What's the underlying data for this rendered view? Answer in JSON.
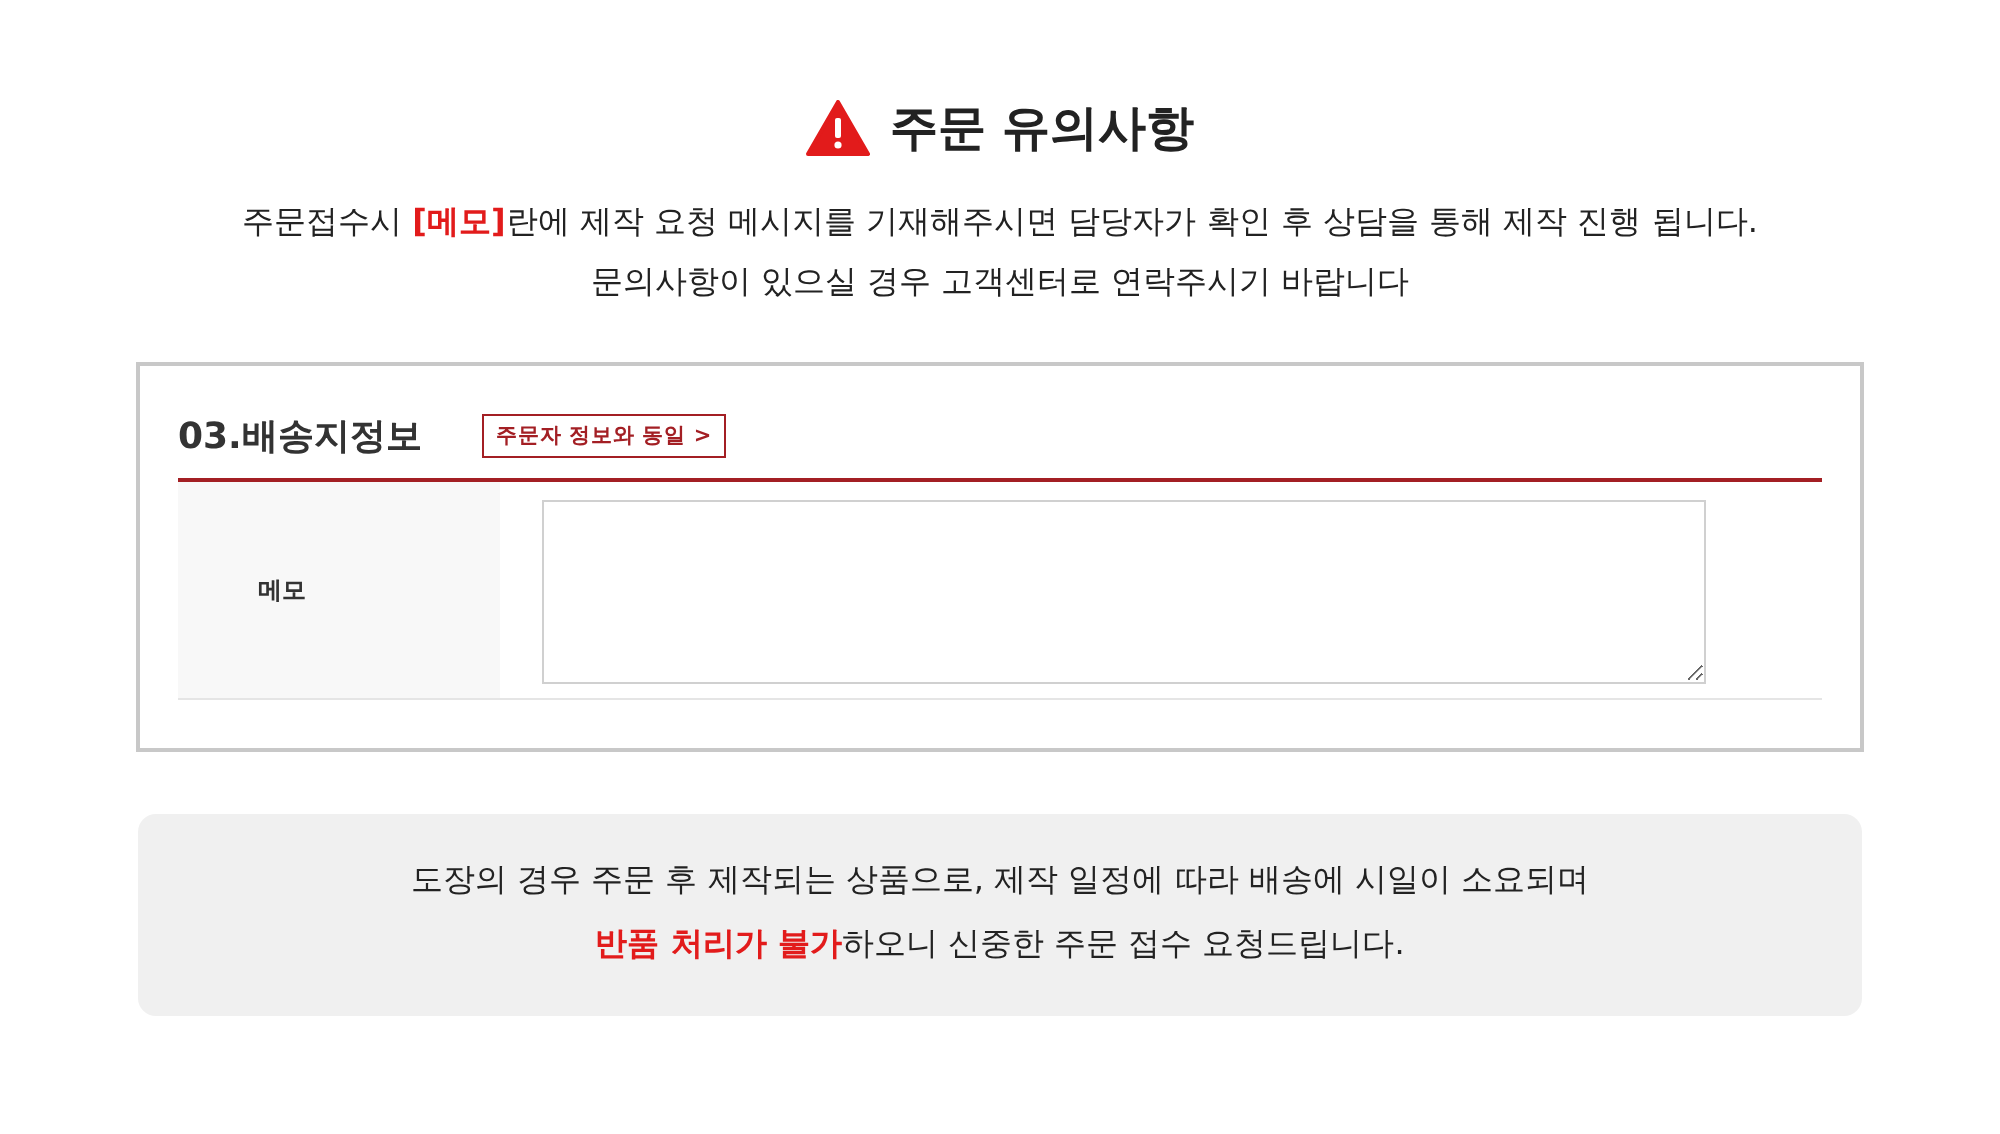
{
  "header": {
    "title": "주문 유의사항",
    "lines": [
      "주문접수시 **[메모]**란에 제작 요청 메시지를 기재해주시면 담당자가 확인 후 상담을 통해 제작 진행 됩니다.",
      "문의사항이 있으실 경우 고객센터로 연락주시기 바랍니다"
    ]
  },
  "section": {
    "title": "03.배송지정보",
    "link_button": "주문자 정보와 동일 >",
    "fields": [
      {
        "label": "메모",
        "kind": "textarea"
      }
    ]
  },
  "notice": {
    "lines": [
      "도장의 경우 주문 후 제작되는 상품으로, 제작 일정에 따라 배송에 시일이 소요되며",
      "**반품 처리가 불가**하오니 신중한 주문 접수 요청드립니다."
    ]
  }
}
